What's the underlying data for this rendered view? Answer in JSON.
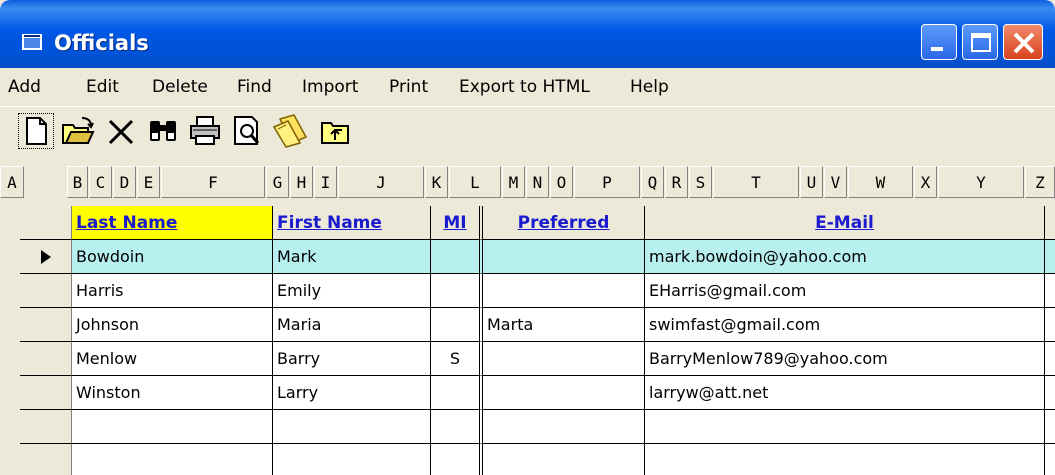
{
  "window": {
    "title": "Officials"
  },
  "menu": [
    "Add",
    "Edit",
    "Delete",
    "Find",
    "Import",
    "Print",
    "Export to HTML",
    "Help"
  ],
  "toolbar": [
    "new-document-icon",
    "open-folder-icon",
    "delete-x-icon",
    "binoculars-find-icon",
    "printer-icon",
    "print-preview-icon",
    "folder-open-icon",
    "up-folder-icon"
  ],
  "letters": [
    "A",
    "B",
    "C",
    "D",
    "E",
    "F",
    "G",
    "H",
    "I",
    "J",
    "K",
    "L",
    "M",
    "N",
    "O",
    "P",
    "Q",
    "R",
    "S",
    "T",
    "U",
    "V",
    "W",
    "X",
    "Y",
    "Z"
  ],
  "grid": {
    "columns": [
      "Last Name",
      "First Name",
      "MI",
      "Preferred",
      "E-Mail"
    ],
    "rows": [
      [
        "Bowdoin",
        "Mark",
        "",
        "",
        "mark.bowdoin@yahoo.com"
      ],
      [
        "Harris",
        "Emily",
        "",
        "",
        "EHarris@gmail.com"
      ],
      [
        "Johnson",
        "Maria",
        "",
        "Marta",
        "swimfast@gmail.com"
      ],
      [
        "Menlow",
        "Barry",
        "S",
        "",
        "BarryMenlow789@yahoo.com"
      ],
      [
        "Winston",
        "Larry",
        "",
        "",
        "larryw@att.net"
      ],
      [
        "",
        "",
        "",
        "",
        ""
      ],
      [
        "",
        "",
        "",
        "",
        ""
      ]
    ],
    "selected_row": 0
  },
  "colors": {
    "titlebar": "#0054e3",
    "selected_row": "#b8f0f0",
    "header_highlight": "#ffff00",
    "header_text": "#1a1acf"
  }
}
